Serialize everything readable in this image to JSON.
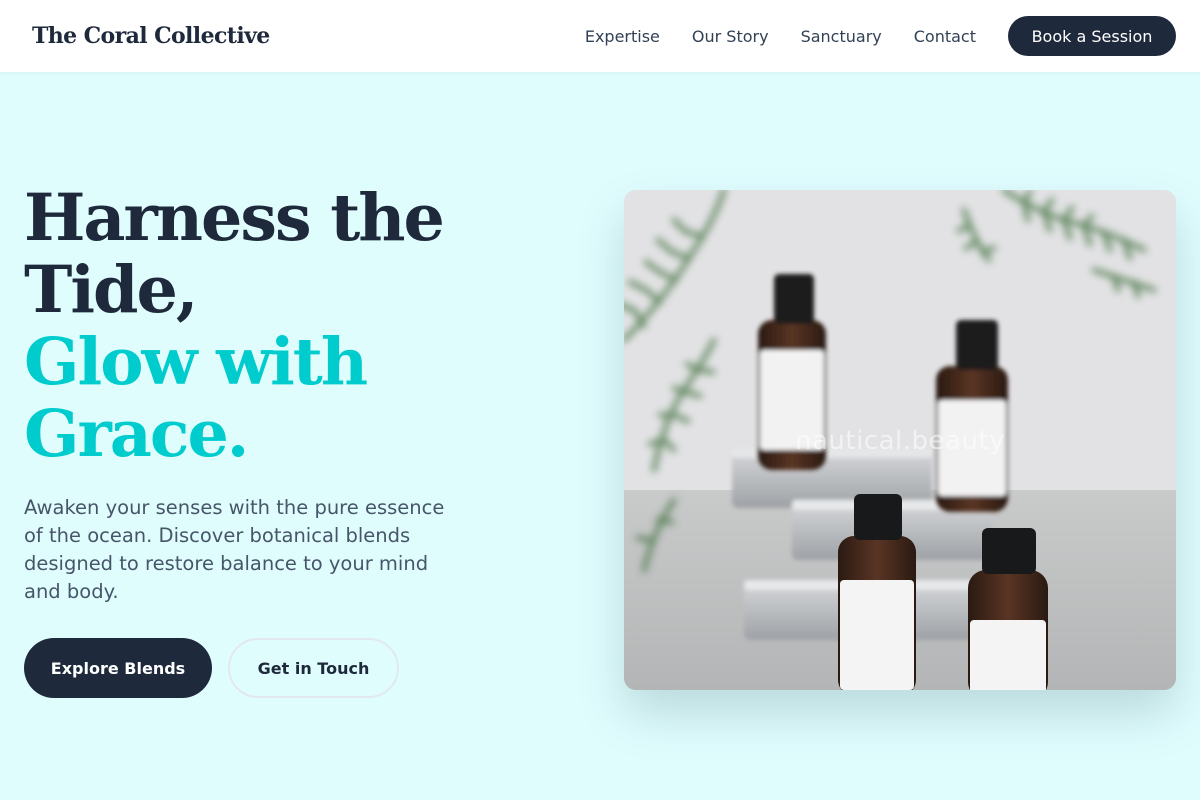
{
  "nav": {
    "brand": "The Coral Collective",
    "links": [
      "Expertise",
      "Our Story",
      "Sanctuary",
      "Contact"
    ],
    "cta": "Book a Session"
  },
  "hero": {
    "title_lines": [
      "Harness the",
      "Tide,"
    ],
    "accent_lines": [
      "Glow with",
      "Grace."
    ],
    "description": "Awaken your senses with the pure essence of the ocean. Discover botanical blends designed to restore balance to your mind and body.",
    "primary_button": "Explore Blends",
    "secondary_button": "Get in Touch",
    "image_watermark": "nautical.beauty"
  },
  "colors": {
    "page_background": "#e0fdfe",
    "navy": "#1e293b",
    "accent_cyan": "#00cccd",
    "body_text": "#475569"
  }
}
